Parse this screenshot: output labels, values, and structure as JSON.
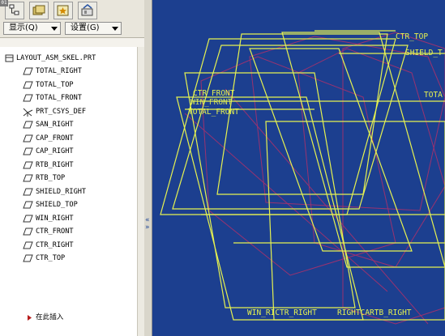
{
  "corner_badge": "01",
  "tabs": [
    {
      "name": "model-tree-tab",
      "icon": "model-tree-icon"
    },
    {
      "name": "folder-browser-tab",
      "icon": "folder-icon"
    },
    {
      "name": "favorites-tab",
      "icon": "favorites-icon"
    },
    {
      "name": "tools-tab",
      "icon": "tools-icon"
    }
  ],
  "menus": {
    "show_label": "显示(Q)",
    "settings_label": "设置(G)"
  },
  "tree": {
    "root_label": "LAYOUT_ASM_SKEL.PRT",
    "items": [
      {
        "label": "TOTAL_RIGHT",
        "icon": "datum-plane-icon"
      },
      {
        "label": "TOTAL_TOP",
        "icon": "datum-plane-icon"
      },
      {
        "label": "TOTAL_FRONT",
        "icon": "datum-plane-icon"
      },
      {
        "label": "PRT_CSYS_DEF",
        "icon": "coordinate-system-icon"
      },
      {
        "label": "SAN_RIGHT",
        "icon": "datum-plane-icon"
      },
      {
        "label": "CAP_FRONT",
        "icon": "datum-plane-icon"
      },
      {
        "label": "CAP_RIGHT",
        "icon": "datum-plane-icon"
      },
      {
        "label": "RTB_RIGHT",
        "icon": "datum-plane-icon"
      },
      {
        "label": "RTB_TOP",
        "icon": "datum-plane-icon"
      },
      {
        "label": "SHIELD_RIGHT",
        "icon": "datum-plane-icon"
      },
      {
        "label": "SHIELD_TOP",
        "icon": "datum-plane-icon"
      },
      {
        "label": "WIN_RIGHT",
        "icon": "datum-plane-icon"
      },
      {
        "label": "CTR_FRONT",
        "icon": "datum-plane-icon"
      },
      {
        "label": "CTR_RIGHT",
        "icon": "datum-plane-icon"
      },
      {
        "label": "CTR_TOP",
        "icon": "datum-plane-icon"
      }
    ],
    "insert_label": "在此插入"
  },
  "viewport": {
    "labels": {
      "ctr_top": "CTR_TOP",
      "shield": "SHIELD_T",
      "total": "TOTA",
      "ctr_front": "CTR_FRONT",
      "win_front": "WIN_FRONT",
      "total_front": "TOTAL_FRONT",
      "bottom_left": "WIN_RICTR_RIGHT",
      "bottom_right": "RIGHTCARTB_RIGHT"
    },
    "colors": {
      "background": "#1c3f8f",
      "datum_planes": "#e6f250",
      "hidden_planes": "#b0306a"
    }
  }
}
